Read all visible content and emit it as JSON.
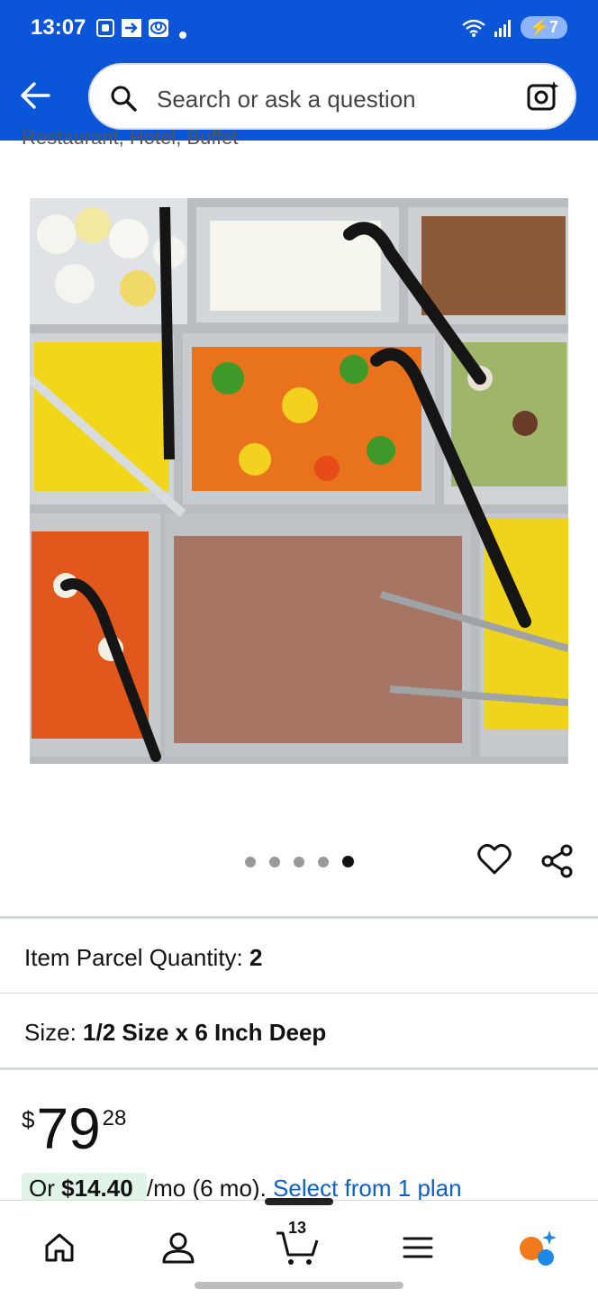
{
  "status_bar": {
    "time": "13:07",
    "battery": "7"
  },
  "search": {
    "placeholder": "Search or ask a question"
  },
  "breadcrumb": "Restaurant, Hotel, Buffet",
  "gallery": {
    "image_count": 5,
    "active_index": 4
  },
  "details": {
    "parcel_label": "Item Parcel Quantity:",
    "parcel_value": "2",
    "size_label": "Size:",
    "size_value": "1/2 Size x 6 Inch Deep"
  },
  "price": {
    "symbol": "$",
    "whole": "79",
    "fraction": "28"
  },
  "plan": {
    "or_text": "Or",
    "monthly": "$14.40",
    "term": "/mo (6 mo).",
    "link": "Select from 1 plan"
  },
  "bottom_nav": {
    "cart_count": "13"
  },
  "icons": [
    "back-arrow-icon",
    "search-icon",
    "camera-icon",
    "heart-icon",
    "share-icon",
    "home-icon",
    "account-icon",
    "cart-icon",
    "menu-icon",
    "assistant-icon"
  ],
  "colors": {
    "header": "#0a55d8",
    "link": "#0b61c8",
    "plan_pill": "#dff3e7"
  }
}
